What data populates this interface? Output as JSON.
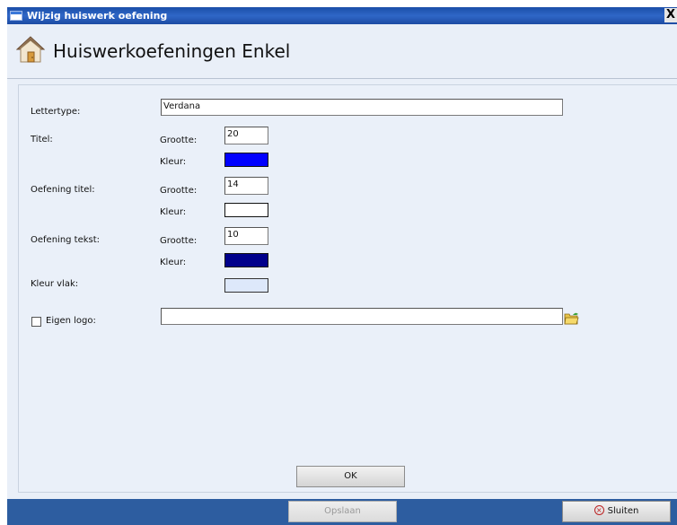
{
  "window": {
    "title": "Wijzig huiswerk oefening",
    "close_glyph": "X"
  },
  "header": {
    "title": "Huiswerkoefeningen Enkel",
    "icon": "house-icon"
  },
  "form": {
    "lettertype": {
      "label": "Lettertype:",
      "value": "Verdana"
    },
    "titel": {
      "label": "Titel:",
      "grootte_label": "Grootte:",
      "grootte_value": "20",
      "kleur_label": "Kleur:",
      "kleur_color": "#0000ff"
    },
    "oefening_titel": {
      "label": "Oefening titel:",
      "grootte_label": "Grootte:",
      "grootte_value": "14",
      "kleur_label": "Kleur:",
      "kleur_color": "#ffffff"
    },
    "oefening_tekst": {
      "label": "Oefening tekst:",
      "grootte_label": "Grootte:",
      "grootte_value": "10",
      "kleur_label": "Kleur:",
      "kleur_color": "#00008b"
    },
    "kleur_vlak": {
      "label": "Kleur vlak:",
      "color": "#dde8fa"
    },
    "eigen_logo": {
      "label": "Eigen logo:",
      "checked": false,
      "value": "",
      "browse_icon": "folder-open-icon"
    }
  },
  "buttons": {
    "ok": "OK",
    "opslaan": "Opslaan",
    "sluiten": "Sluiten",
    "sluiten_icon": "close-circle-icon"
  }
}
